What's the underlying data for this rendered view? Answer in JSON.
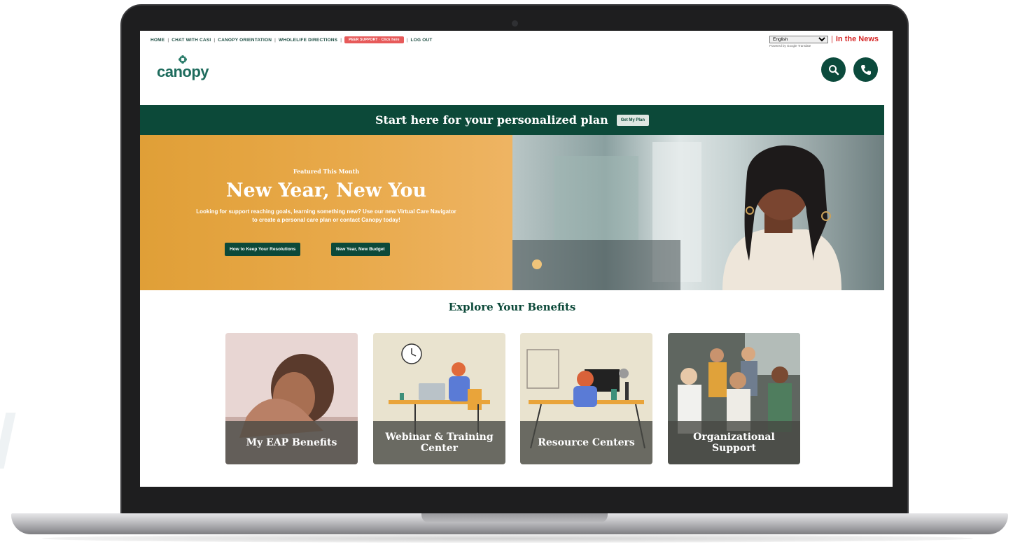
{
  "nav": {
    "items": [
      "HOME",
      "CHAT WITH CASI",
      "CANOPY ORIENTATION",
      "WHOLELIFE DIRECTIONS",
      "PEER SUPPORT · Click here",
      "LOG OUT"
    ],
    "separator": "|"
  },
  "language": {
    "selected": "English",
    "powered_by": "Powered by Google Translate",
    "news_label": "In the News",
    "bar": "|"
  },
  "brand": {
    "name": "canopy",
    "logo_icon": "flower-icon"
  },
  "header_buttons": {
    "search_icon": "search-icon",
    "phone_icon": "phone-icon"
  },
  "plan_bar": {
    "text": "Start here for your personalized plan",
    "button": "Get My Plan"
  },
  "hero": {
    "kicker": "Featured This Month",
    "title": "New Year, New You",
    "body": "Looking for support reaching goals, learning something new? Use our new Virtual Care Navigator to create a personal care plan or contact Canopy today!",
    "button_1": "How to Keep Your Resolutions",
    "button_2": "New Year, New Budget"
  },
  "explore": {
    "heading": "Explore Your Benefits",
    "cards": [
      {
        "label": "My EAP Benefits"
      },
      {
        "label": "Webinar & Training Center"
      },
      {
        "label": "Resource Centers"
      },
      {
        "label": "Organizational Support"
      }
    ]
  },
  "colors": {
    "brand_green": "#0c4939",
    "hero_orange": "#e8a94a",
    "news_red": "#d62828",
    "peer_pill": "#e75a5a"
  }
}
